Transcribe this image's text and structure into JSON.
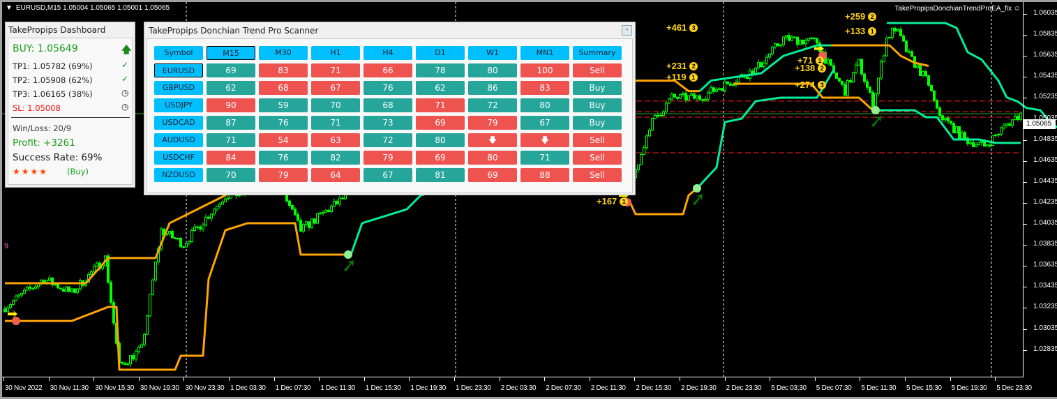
{
  "header": {
    "symbol_info": "EURUSD,M15  1.05004 1.05065 1.05001 1.05065",
    "ea_name": "TakePropipsDonchianTrendProEA_fix",
    "current_price": "1.05065"
  },
  "dashboard": {
    "title": "TakePropips Dashboard",
    "signal": "BUY: 1.05649",
    "tp1": "TP1: 1.05782 (69%)",
    "tp2": "TP2: 1.05908 (62%)",
    "tp3": "TP3: 1.06165 (38%)",
    "sl": "SL:   1.05008",
    "win_loss": "Win/Loss: 20/9",
    "profit": "Profit: +3261",
    "success_rate": "Success Rate: 69%",
    "stars": "★★★★",
    "rating_dir": "(Buy)"
  },
  "scanner": {
    "title": "TakePropips Donchian Trend Pro Scanner",
    "minimize": "-",
    "columns": [
      "Symbol",
      "M15",
      "M30",
      "H1",
      "H4",
      "D1",
      "W1",
      "MN1",
      "Summary"
    ],
    "rows": [
      {
        "symbol": "EURUSD",
        "cells": [
          [
            "69",
            "b"
          ],
          [
            "83",
            "s"
          ],
          [
            "71",
            "s"
          ],
          [
            "66",
            "s"
          ],
          [
            "78",
            "b"
          ],
          [
            "80",
            "b"
          ],
          [
            "100",
            "s"
          ]
        ],
        "summary": [
          "Sell",
          "s"
        ]
      },
      {
        "symbol": "GBPUSD",
        "cells": [
          [
            "62",
            "b"
          ],
          [
            "68",
            "s"
          ],
          [
            "67",
            "s"
          ],
          [
            "76",
            "b"
          ],
          [
            "62",
            "b"
          ],
          [
            "86",
            "b"
          ],
          [
            "83",
            "s"
          ]
        ],
        "summary": [
          "Buy",
          "b"
        ]
      },
      {
        "symbol": "USDJPY",
        "cells": [
          [
            "90",
            "s"
          ],
          [
            "59",
            "b"
          ],
          [
            "70",
            "b"
          ],
          [
            "68",
            "b"
          ],
          [
            "71",
            "s"
          ],
          [
            "72",
            "b"
          ],
          [
            "80",
            "b"
          ]
        ],
        "summary": [
          "Buy",
          "b"
        ]
      },
      {
        "symbol": "USDCAD",
        "cells": [
          [
            "87",
            "b"
          ],
          [
            "76",
            "b"
          ],
          [
            "71",
            "b"
          ],
          [
            "73",
            "b"
          ],
          [
            "69",
            "s"
          ],
          [
            "79",
            "s"
          ],
          [
            "67",
            "b"
          ]
        ],
        "summary": [
          "Buy",
          "b"
        ]
      },
      {
        "symbol": "AUDUSD",
        "cells": [
          [
            "71",
            "b"
          ],
          [
            "54",
            "s"
          ],
          [
            "63",
            "s"
          ],
          [
            "72",
            "b"
          ],
          [
            "80",
            "b"
          ],
          [
            "🡇",
            "s"
          ],
          [
            "🡇",
            "s"
          ]
        ],
        "summary": [
          "Sell",
          "s"
        ]
      },
      {
        "symbol": "USDCHF",
        "cells": [
          [
            "84",
            "s"
          ],
          [
            "76",
            "b"
          ],
          [
            "82",
            "b"
          ],
          [
            "79",
            "s"
          ],
          [
            "69",
            "s"
          ],
          [
            "80",
            "s"
          ],
          [
            "71",
            "b"
          ]
        ],
        "summary": [
          "Sell",
          "s"
        ]
      },
      {
        "symbol": "NZDUSD",
        "cells": [
          [
            "70",
            "b"
          ],
          [
            "79",
            "s"
          ],
          [
            "64",
            "s"
          ],
          [
            "67",
            "b"
          ],
          [
            "81",
            "b"
          ],
          [
            "69",
            "s"
          ],
          [
            "88",
            "s"
          ]
        ],
        "summary": [
          "Sell",
          "s"
        ]
      }
    ]
  },
  "price_axis": [
    "1.06035",
    "1.05835",
    "1.05635",
    "1.05435",
    "1.05235",
    "1.05035",
    "1.04835",
    "1.04635",
    "1.04435",
    "1.04235",
    "1.04035",
    "1.03835",
    "1.03635",
    "1.03435",
    "1.03235",
    "1.03035",
    "1.02835"
  ],
  "time_axis": [
    "30 Nov 2022",
    "30 Nov 11:30",
    "30 Nov 15:30",
    "30 Nov 19:30",
    "30 Nov 23:30",
    "1 Dec 03:30",
    "1 Dec 07:30",
    "1 Dec 11:30",
    "1 Dec 15:30",
    "1 Dec 19:30",
    "1 Dec 23:30",
    "2 Dec 03:30",
    "2 Dec 07:30",
    "2 Dec 11:30",
    "2 Dec 15:30",
    "2 Dec 19:30",
    "2 Dec 23:30",
    "5 Dec 03:30",
    "5 Dec 07:30",
    "5 Dec 11:30",
    "5 Dec 15:30",
    "5 Dec 19:30",
    "5 Dec 23:30"
  ],
  "trade_labels": [
    {
      "text": "+461",
      "num": "3",
      "bar": 238,
      "price": 1.0588
    },
    {
      "text": "+231",
      "num": "2",
      "bar": 238,
      "price": 1.0552
    },
    {
      "text": "+119",
      "num": "1",
      "bar": 238,
      "price": 1.0541
    },
    {
      "text": "+167",
      "num": "1",
      "bar": 213,
      "price": 1.0423
    },
    {
      "text": "+71",
      "num": "1",
      "bar": 285,
      "price": 1.0557
    },
    {
      "text": "+138",
      "num": "2",
      "bar": 284,
      "price": 1.055
    },
    {
      "text": "+274",
      "num": "3",
      "bar": 284,
      "price": 1.0534
    },
    {
      "text": "+259",
      "num": "2",
      "bar": 302,
      "price": 1.0599
    },
    {
      "text": "+133",
      "num": "1",
      "bar": 302,
      "price": 1.0585
    },
    {
      "text": "9",
      "num": "",
      "bar": 0,
      "price": 1.0379
    }
  ],
  "chart_data": {
    "type": "candlestick",
    "symbol": "EURUSD",
    "timeframe": "M15",
    "ylim": [
      1.02835,
      1.06035
    ],
    "bars_per_time_label": 16,
    "close_path": [
      [
        1,
        1.03224
      ],
      [
        15,
        1.0349
      ],
      [
        25,
        1.03357
      ],
      [
        37,
        1.03689
      ],
      [
        42,
        1.0266
      ],
      [
        50,
        1.02825
      ],
      [
        57,
        1.03955
      ],
      [
        65,
        1.03822
      ],
      [
        80,
        1.04287
      ],
      [
        100,
        1.04354
      ],
      [
        107,
        1.03955
      ],
      [
        117,
        1.04154
      ],
      [
        127,
        1.04354
      ],
      [
        150,
        1.04487
      ],
      [
        227,
        1.04487
      ],
      [
        232,
        1.04952
      ],
      [
        240,
        1.05218
      ],
      [
        250,
        1.05218
      ],
      [
        257,
        1.05317
      ],
      [
        270,
        1.05483
      ],
      [
        280,
        1.05782
      ],
      [
        292,
        1.05749
      ],
      [
        297,
        1.05483
      ],
      [
        302,
        1.05284
      ],
      [
        307,
        1.0555
      ],
      [
        312,
        1.05151
      ],
      [
        317,
        1.05782
      ],
      [
        320,
        1.05882
      ],
      [
        325,
        1.05616
      ],
      [
        332,
        1.05351
      ],
      [
        335,
        1.05085
      ],
      [
        345,
        1.04819
      ],
      [
        352,
        1.04753
      ],
      [
        360,
        1.04965
      ],
      [
        365,
        1.05065
      ]
    ],
    "bands": [
      {
        "color": "#ffa500",
        "points": [
          [
            1,
            1.03091
          ],
          [
            25,
            1.03091
          ],
          [
            38,
            1.03224
          ],
          [
            41,
            1.03224
          ],
          [
            42,
            1.02626
          ],
          [
            62,
            1.02626
          ],
          [
            64,
            1.02759
          ],
          [
            72,
            1.02759
          ],
          [
            74,
            1.0349
          ],
          [
            80,
            1.03955
          ],
          [
            88,
            1.04022
          ],
          [
            105,
            1.04022
          ],
          [
            107,
            1.03723
          ],
          [
            125,
            1.03723
          ]
        ]
      },
      {
        "color": "#00ee99",
        "points": [
          [
            125,
            1.03723
          ],
          [
            129,
            1.04022
          ],
          [
            145,
            1.04154
          ],
          [
            150,
            1.04287
          ],
          [
            160,
            1.04354
          ]
        ]
      },
      {
        "color": "#ffa500",
        "points": [
          [
            1,
            1.0345
          ],
          [
            14,
            1.0345
          ],
          [
            30,
            1.0345
          ],
          [
            38,
            1.0369
          ],
          [
            55,
            1.0369
          ],
          [
            60,
            1.04022
          ],
          [
            75,
            1.04221
          ],
          [
            85,
            1.04354
          ]
        ]
      },
      {
        "color": "#ffa500",
        "points": [
          [
            220,
            1.0538
          ],
          [
            241,
            1.0538
          ],
          [
            246,
            1.0528
          ],
          [
            250,
            1.0528
          ]
        ]
      },
      {
        "color": "#00ee99",
        "points": [
          [
            250,
            1.0528
          ],
          [
            254,
            1.0538
          ],
          [
            272,
            1.0545
          ],
          [
            280,
            1.05616
          ],
          [
            292,
            1.05716
          ],
          [
            297,
            1.05716
          ]
        ]
      },
      {
        "color": "#ffa500",
        "points": [
          [
            297,
            1.05716
          ],
          [
            318,
            1.05716
          ],
          [
            322,
            1.05616
          ],
          [
            327,
            1.0555
          ],
          [
            332,
            1.0552
          ]
        ]
      },
      {
        "color": "#ffa500",
        "points": [
          [
            225,
            1.04221
          ],
          [
            227,
            1.04108
          ],
          [
            244,
            1.04108
          ],
          [
            246,
            1.04287
          ],
          [
            249,
            1.04354
          ]
        ]
      },
      {
        "color": "#00ee99",
        "points": [
          [
            249,
            1.04354
          ],
          [
            256,
            1.04553
          ],
          [
            259,
            1.04985
          ],
          [
            265,
            1.05018
          ],
          [
            270,
            1.05184
          ],
          [
            279,
            1.05218
          ],
          [
            292,
            1.05218
          ],
          [
            298,
            1.05483
          ],
          [
            295,
            1.0535
          ]
        ]
      },
      {
        "color": "#ffa500",
        "points": [
          [
            262,
            1.0535
          ],
          [
            290,
            1.05351
          ],
          [
            294,
            1.05218
          ],
          [
            307,
            1.05218
          ],
          [
            312,
            1.05098
          ],
          [
            313,
            1.05098
          ]
        ]
      },
      {
        "color": "#00ee99",
        "points": [
          [
            313,
            1.05098
          ],
          [
            327,
            1.05098
          ],
          [
            331,
            1.05032
          ],
          [
            335,
            1.05032
          ],
          [
            341,
            1.04819
          ],
          [
            350,
            1.04819
          ],
          [
            356,
            1.04787
          ],
          [
            365,
            1.04787
          ]
        ]
      },
      {
        "color": "#00ee99",
        "points": [
          [
            317,
            1.05929
          ],
          [
            338,
            1.05929
          ],
          [
            342,
            1.05882
          ],
          [
            346,
            1.0565
          ],
          [
            351,
            1.0558
          ],
          [
            357,
            1.0538
          ],
          [
            360,
            1.0522
          ],
          [
            364,
            1.0518
          ],
          [
            367,
            1.0512
          ],
          [
            372,
            1.05098
          ],
          [
            376,
            1.0497
          ],
          [
            379,
            1.0492
          ],
          [
            382,
            1.0495
          ],
          [
            384,
            1.05065
          ]
        ]
      }
    ],
    "levels": [
      1.05185,
      1.05085,
      1.05032,
      1.04693
    ],
    "signals": [
      {
        "type": "sell",
        "bar": 5,
        "price": 1.03091
      },
      {
        "type": "sell",
        "bar": 224,
        "price": 1.04221
      },
      {
        "type": "sell",
        "bar": 294,
        "price": 1.05618
      },
      {
        "type": "buy",
        "bar": 124,
        "price": 1.03723
      },
      {
        "type": "buy",
        "bar": 249,
        "price": 1.04354
      },
      {
        "type": "buy",
        "bar": 313,
        "price": 1.05098
      }
    ]
  }
}
